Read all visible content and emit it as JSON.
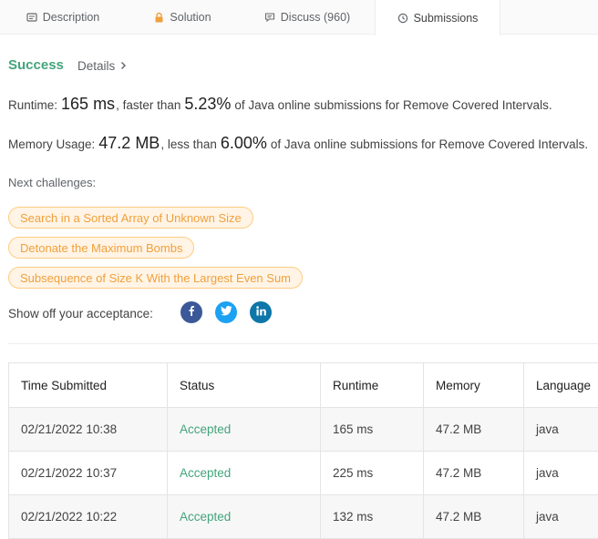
{
  "tabs": [
    {
      "label": "Description",
      "icon": "description-icon"
    },
    {
      "label": "Solution",
      "icon": "lock-icon"
    },
    {
      "label": "Discuss (960)",
      "icon": "comment-icon"
    },
    {
      "label": "Submissions",
      "icon": "clock-icon",
      "active": true
    }
  ],
  "result": {
    "status": "Success",
    "details_label": "Details",
    "runtime": {
      "label": "Runtime:",
      "value": "165 ms",
      "mid": ", faster than",
      "percent": "5.23%",
      "suffix": "of Java online submissions for Remove Covered Intervals."
    },
    "memory": {
      "label": "Memory Usage:",
      "value": "47.2 MB",
      "mid": ", less than",
      "percent": "6.00%",
      "suffix": "of Java online submissions for Remove Covered Intervals."
    }
  },
  "next_challenges": {
    "label": "Next challenges:",
    "items": [
      "Search in a Sorted Array of Unknown Size",
      "Detonate the Maximum Bombs",
      "Subsequence of Size K With the Largest Even Sum"
    ]
  },
  "share": {
    "label": "Show off your acceptance:",
    "networks": [
      "facebook",
      "twitter",
      "linkedin"
    ]
  },
  "colors": {
    "success": "#43a47c",
    "chip_text": "#f0a03c",
    "chip_border": "#ffcb80",
    "facebook": "#3b5998",
    "twitter": "#1da1f2",
    "linkedin": "#0e76a8"
  },
  "table": {
    "headers": [
      "Time Submitted",
      "Status",
      "Runtime",
      "Memory",
      "Language"
    ],
    "rows": [
      [
        "02/21/2022 10:38",
        "Accepted",
        "165 ms",
        "47.2 MB",
        "java"
      ],
      [
        "02/21/2022 10:37",
        "Accepted",
        "225 ms",
        "47.2 MB",
        "java"
      ],
      [
        "02/21/2022 10:22",
        "Accepted",
        "132 ms",
        "47.2 MB",
        "java"
      ]
    ]
  }
}
